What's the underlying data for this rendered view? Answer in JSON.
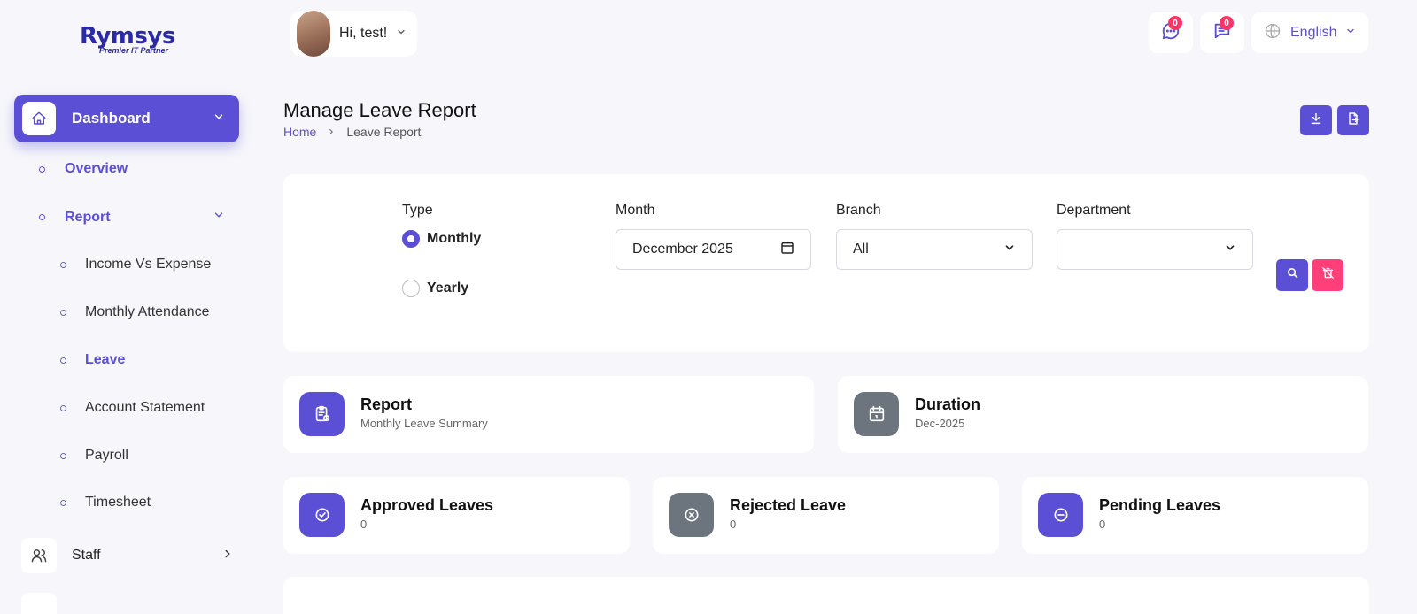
{
  "brand": {
    "name": "Rymsys",
    "tagline": "Premier IT Partner"
  },
  "sidebar": {
    "dashboard_label": "Dashboard",
    "overview_label": "Overview",
    "report_label": "Report",
    "report_items": [
      {
        "label": "Income Vs Expense",
        "active": false
      },
      {
        "label": "Monthly Attendance",
        "active": false
      },
      {
        "label": "Leave",
        "active": true
      },
      {
        "label": "Account Statement",
        "active": false
      },
      {
        "label": "Payroll",
        "active": false
      },
      {
        "label": "Timesheet",
        "active": false
      }
    ],
    "staff_label": "Staff"
  },
  "topbar": {
    "greeting": "Hi, test!",
    "messages_count": "0",
    "notifications_count": "0",
    "language": "English"
  },
  "page": {
    "title": "Manage Leave Report",
    "breadcrumb_home": "Home",
    "breadcrumb_current": "Leave Report"
  },
  "filters": {
    "type_label": "Type",
    "type_monthly": "Monthly",
    "type_yearly": "Yearly",
    "selected_type": "Monthly",
    "month_label": "Month",
    "month_value": "December 2025",
    "branch_label": "Branch",
    "branch_value": "All",
    "department_label": "Department",
    "department_value": ""
  },
  "summary": {
    "report_title": "Report",
    "report_sub": "Monthly Leave Summary",
    "duration_title": "Duration",
    "duration_sub": "Dec-2025"
  },
  "stats": {
    "approved_title": "Approved Leaves",
    "approved_value": "0",
    "rejected_title": "Rejected Leave",
    "rejected_value": "0",
    "pending_title": "Pending Leaves",
    "pending_value": "0"
  },
  "colors": {
    "primary": "#5b4fd6",
    "danger": "#ff3f7a",
    "badge": "#ff3366",
    "neutral_icon": "#6c757d"
  },
  "icons": {
    "home": "home-icon",
    "staff": "users-icon",
    "messages": "message-dots-icon",
    "notifications": "message-lines-icon",
    "language": "globe-icon"
  }
}
